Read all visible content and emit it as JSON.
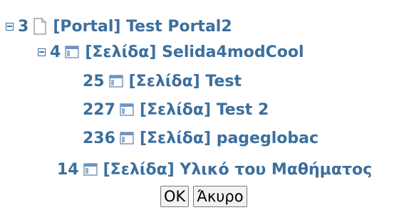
{
  "tree": [
    {
      "toggle": true,
      "num": "3",
      "icon": "page",
      "label": "[Portal] Test Portal2"
    },
    {
      "toggle": true,
      "num": "4",
      "icon": "window",
      "label": "[Σελίδα] Selida4modCool"
    },
    {
      "toggle": false,
      "num": "25",
      "icon": "window",
      "label": "[Σελίδα] Test"
    },
    {
      "toggle": false,
      "num": "227",
      "icon": "window",
      "label": "[Σελίδα] Test 2"
    },
    {
      "toggle": false,
      "num": "236",
      "icon": "window",
      "label": "[Σελίδα] pageglobac"
    },
    {
      "toggle": false,
      "num": "14",
      "icon": "window",
      "label": "[Σελίδα] Υλικό του Μαθήματος"
    }
  ],
  "buttons": {
    "ok_label": "OK",
    "cancel_label": "Άκυρο"
  },
  "colors": {
    "link": "#3b6f9e"
  }
}
